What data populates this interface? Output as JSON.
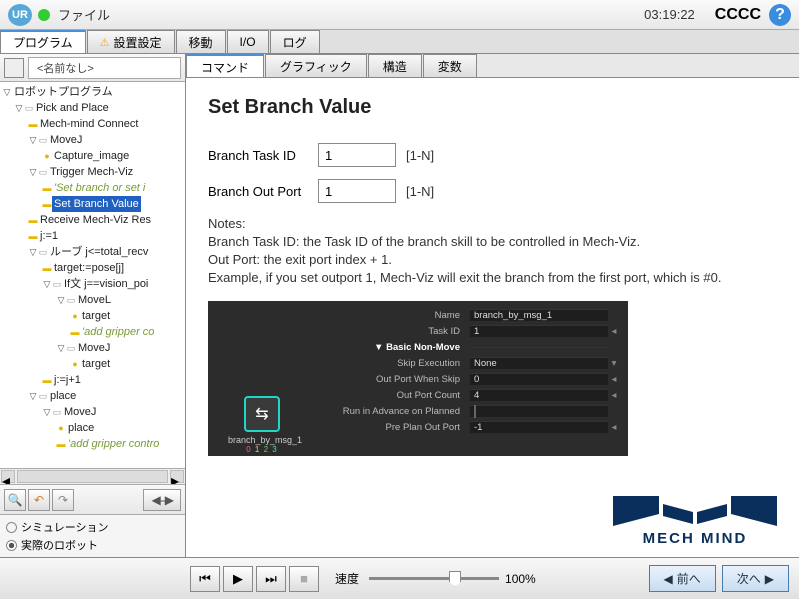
{
  "topbar": {
    "file_label": "ファイル",
    "clock": "03:19:22",
    "cccc": "CCCC"
  },
  "main_tabs": {
    "program": "プログラム",
    "install": "設置設定",
    "move": "移動",
    "io": "I/O",
    "log": "ログ"
  },
  "left": {
    "unnamed": "<名前なし>",
    "tree": {
      "root": "ロボットプログラム",
      "pick_place": "Pick and Place",
      "mech_connect": "Mech-mind Connect",
      "movej1": "MoveJ",
      "capture": "Capture_image",
      "trigger": "Trigger Mech-Viz",
      "com_set_branch": "'Set branch or set i",
      "set_branch_value": "Set Branch Value",
      "receive": "Receive Mech-Viz Res",
      "j1": "j:=1",
      "loop": "ルーブ j<=total_recv",
      "target_assign": "target:=pose[j]",
      "if_stmt": "If文 j==vision_poi",
      "movel": "MoveL",
      "target": "target",
      "com_add_gripper": "'add gripper co",
      "movej2": "MoveJ",
      "target2": "target",
      "jinc": "j:=j+1",
      "place": "place",
      "movej3": "MoveJ",
      "place2": "place",
      "com_add_gripper2": "'add gripper contro"
    },
    "sim": "シミュレーション",
    "real": "実際のロボット"
  },
  "sub_tabs": {
    "command": "コマンド",
    "graphic": "グラフィック",
    "structure": "構造",
    "variable": "変数"
  },
  "detail": {
    "title": "Set Branch Value",
    "task_id_label": "Branch Task ID",
    "task_id_val": "1",
    "task_id_range": "[1-N]",
    "out_port_label": "Branch Out Port",
    "out_port_val": "1",
    "out_port_range": "[1-N]",
    "notes_h": "Notes:",
    "notes_1": "Branch Task ID: the Task ID of the branch skill to be controlled in Mech-Viz.",
    "notes_2": "Out Port: the exit port index + 1.",
    "notes_3": "Example, if you set outport 1, Mech-Viz will exit the branch from the first port, which is #0."
  },
  "dark": {
    "node_label": "branch_by_msg_1",
    "rows": {
      "name_k": "Name",
      "name_v": "branch_by_msg_1",
      "taskid_k": "Task ID",
      "taskid_v": "1",
      "basic_k": "Basic Non-Move",
      "skip_k": "Skip Execution",
      "skip_v": "None",
      "outskip_k": "Out Port When Skip",
      "outskip_v": "0",
      "count_k": "Out Port Count",
      "count_v": "4",
      "run_k": "Run in Advance on Planned",
      "preplan_k": "Pre Plan Out Port",
      "preplan_v": "-1"
    }
  },
  "mechmind": "MECH MIND",
  "bottom": {
    "speed_label": "速度",
    "speed_val": "100%",
    "prev": "前へ",
    "next": "次へ"
  }
}
